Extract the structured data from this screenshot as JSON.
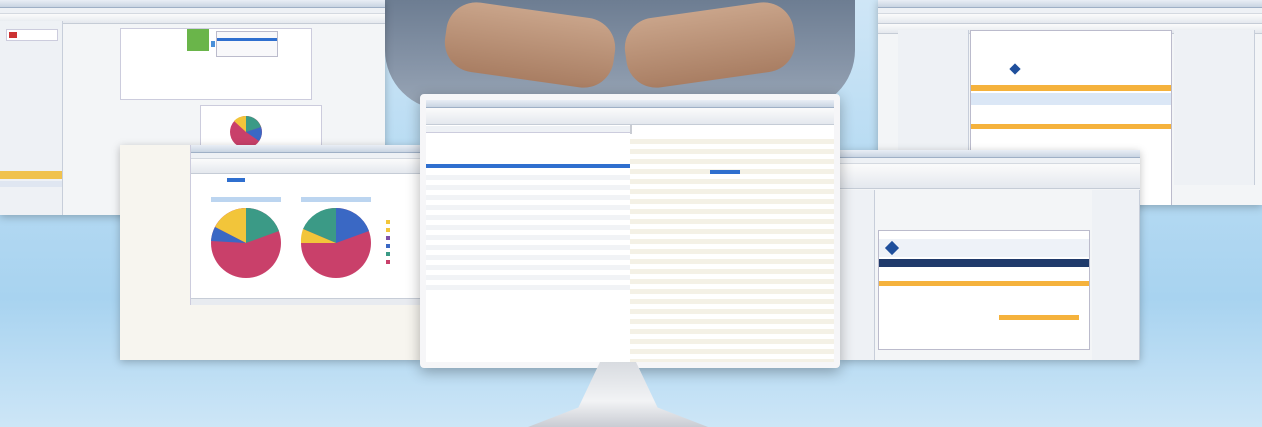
{
  "scene": {
    "description_free": true
  },
  "colors": {
    "background_top": "#cfe6f6",
    "background_bottom": "#a8d3f0",
    "selection_blue": "#2f6fcf",
    "report_orange": "#f5b23c",
    "pie_red": "#c9406a",
    "pie_teal": "#3b9a86",
    "pie_blue": "#3a68c4",
    "pie_yellow": "#f2c53a",
    "pie_purple": "#7d4fa8"
  },
  "icons": [
    "toolbar-icons",
    "folder-icon",
    "pie-chart-icon",
    "monitor-stand-icon"
  ]
}
